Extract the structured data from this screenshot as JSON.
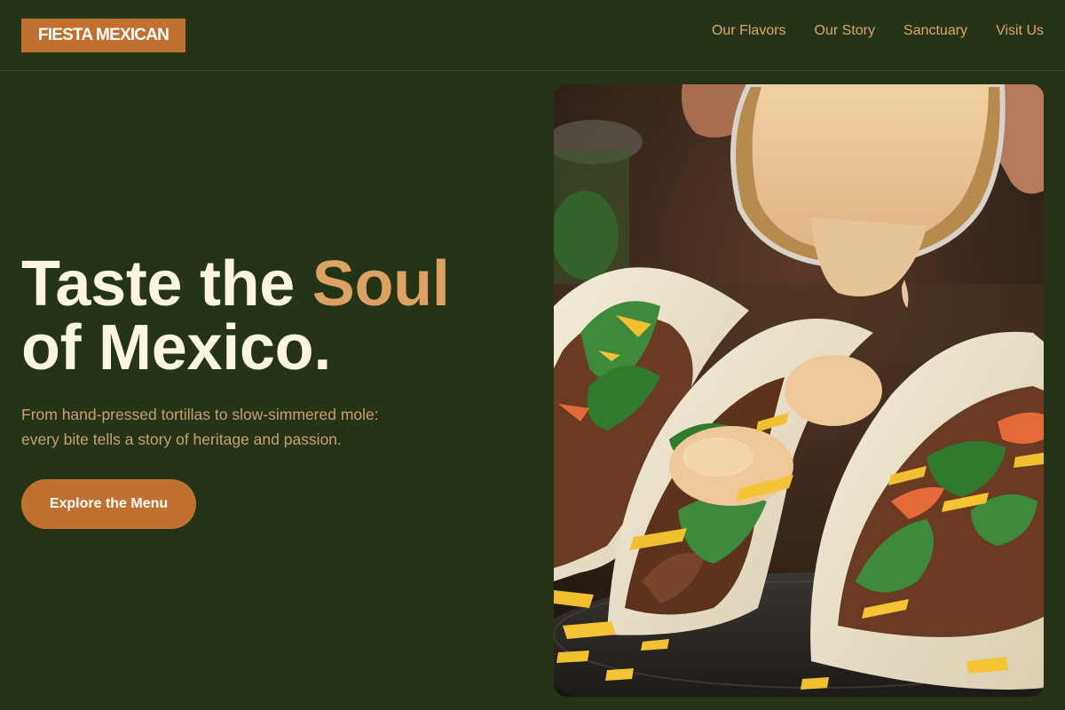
{
  "brand": {
    "name": "FIESTA MEXICAN",
    "accent_color": "#c2702f"
  },
  "nav": {
    "items": [
      {
        "label": "Our Flavors"
      },
      {
        "label": "Our Story"
      },
      {
        "label": "Sanctuary"
      },
      {
        "label": "Visit Us"
      }
    ]
  },
  "hero": {
    "title_part1": "Taste the ",
    "title_accent": "Soul",
    "title_part2": "of Mexico.",
    "subtitle_line1": "From hand-pressed tortillas to slow-simmered mole:",
    "subtitle_line2": "every bite tells a story of heritage and passion.",
    "cta_label": "Explore the Menu",
    "image_subject": "tacos with queso sauce being poured"
  },
  "colors": {
    "background": "#253317",
    "title": "#fbf5e1",
    "title_accent": "#dca263",
    "nav_text": "#d9a868",
    "subtitle": "#c7a06a"
  }
}
